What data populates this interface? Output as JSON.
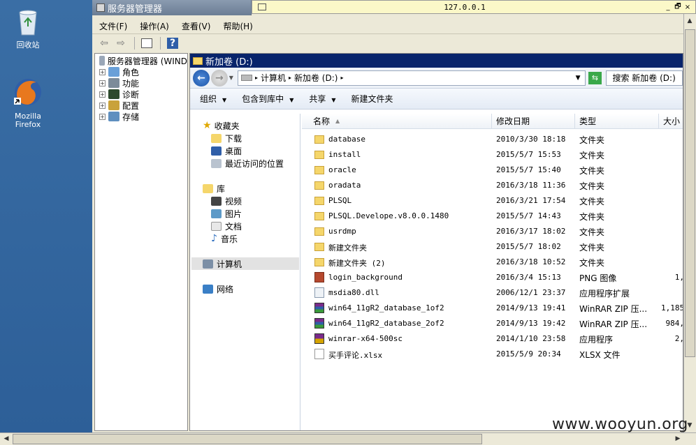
{
  "desktop": {
    "recycle_bin": "回收站",
    "firefox_line1": "Mozilla",
    "firefox_line2": "Firefox"
  },
  "rdp": {
    "title": "127.0.0.1",
    "ctrl_min": "_",
    "ctrl_restore": "🗗",
    "ctrl_close": "×"
  },
  "server_manager": {
    "title": "服务器管理器",
    "menu": [
      "文件(F)",
      "操作(A)",
      "查看(V)",
      "帮助(H)"
    ],
    "toolbar": {
      "back": "⇦",
      "forward": "⇨",
      "help": "?"
    },
    "tree": {
      "root": "服务器管理器 (WIND",
      "items": [
        "角色",
        "功能",
        "诊断",
        "配置",
        "存储"
      ]
    }
  },
  "explorer": {
    "title": "新加卷 (D:)",
    "address": [
      "计算机",
      "新加卷 (D:)"
    ],
    "search_placeholder": "搜索 新加卷 (D:)",
    "commands": [
      "组织",
      "包含到库中",
      "共享",
      "新建文件夹"
    ],
    "nav": {
      "favorites": "收藏夹",
      "favorites_items": [
        "下载",
        "桌面",
        "最近访问的位置"
      ],
      "libraries": "库",
      "library_items": [
        "视频",
        "图片",
        "文档",
        "音乐"
      ],
      "computer": "计算机",
      "network": "网络"
    },
    "columns": [
      "名称",
      "修改日期",
      "类型",
      "大小"
    ],
    "files": [
      {
        "name": "database",
        "date": "2010/3/30 18:18",
        "type": "文件夹",
        "size": "",
        "icon": "folder"
      },
      {
        "name": "install",
        "date": "2015/5/7 15:53",
        "type": "文件夹",
        "size": "",
        "icon": "folder"
      },
      {
        "name": "oracle",
        "date": "2015/5/7 15:40",
        "type": "文件夹",
        "size": "",
        "icon": "folder"
      },
      {
        "name": "oradata",
        "date": "2016/3/18 11:36",
        "type": "文件夹",
        "size": "",
        "icon": "folder"
      },
      {
        "name": "PLSQL",
        "date": "2016/3/21 17:54",
        "type": "文件夹",
        "size": "",
        "icon": "folder"
      },
      {
        "name": "PLSQL.Develope.v8.0.0.1480",
        "date": "2015/5/7 14:43",
        "type": "文件夹",
        "size": "",
        "icon": "folder"
      },
      {
        "name": "usrdmp",
        "date": "2016/3/17 18:02",
        "type": "文件夹",
        "size": "",
        "icon": "folder"
      },
      {
        "name": "新建文件夹",
        "date": "2015/5/7 18:02",
        "type": "文件夹",
        "size": "",
        "icon": "folder"
      },
      {
        "name": "新建文件夹 (2)",
        "date": "2016/3/18 10:52",
        "type": "文件夹",
        "size": "",
        "icon": "folder"
      },
      {
        "name": "login_background",
        "date": "2016/3/4 15:13",
        "type": "PNG 图像",
        "size": "1,",
        "icon": "image"
      },
      {
        "name": "msdia80.dll",
        "date": "2006/12/1 23:37",
        "type": "应用程序扩展",
        "size": "",
        "icon": "dll"
      },
      {
        "name": "win64_11gR2_database_1of2",
        "date": "2014/9/13 19:41",
        "type": "WinRAR ZIP 压...",
        "size": "1,185",
        "icon": "rar"
      },
      {
        "name": "win64_11gR2_database_2of2",
        "date": "2014/9/13 19:42",
        "type": "WinRAR ZIP 压...",
        "size": "984,",
        "icon": "rar"
      },
      {
        "name": "winrar-x64-500sc",
        "date": "2014/1/10 23:58",
        "type": "应用程序",
        "size": "2,",
        "icon": "exe"
      },
      {
        "name": "买手评论.xlsx",
        "date": "2015/5/9 20:34",
        "type": "XLSX 文件",
        "size": "",
        "icon": "file"
      }
    ]
  },
  "watermark": "www.wooyun.org",
  "colors": {
    "title_bar": "#08246b",
    "desktop": "#3a6ea5",
    "folder": "#f5d66b"
  }
}
